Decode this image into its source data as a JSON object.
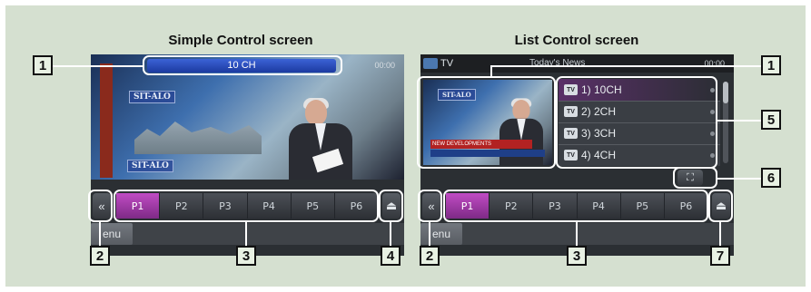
{
  "headings": {
    "simple": "Simple Control screen",
    "list": "List Control screen"
  },
  "simple": {
    "channel_title": "10 CH",
    "clock": "00:00",
    "banner_top": "SIT-ALO",
    "banner_bottom": "SIT-ALO",
    "presets": [
      "P1",
      "P2",
      "P3",
      "P4",
      "P5",
      "P6"
    ],
    "active_preset": "P1",
    "back_button": "«",
    "eject_button": "⏏",
    "menu_label": "enu"
  },
  "list": {
    "source_label": "TV",
    "program_title": "Today's News",
    "clock": "00:00",
    "thumb_banner": "SIT-ALO",
    "thumb_ticker": "NEW DEVELOPMENTS",
    "channels": [
      {
        "icon": "TV",
        "label": "1)  10CH"
      },
      {
        "icon": "TV",
        "label": "2)  2CH"
      },
      {
        "icon": "TV",
        "label": "3)  3CH"
      },
      {
        "icon": "TV",
        "label": "4)  4CH"
      }
    ],
    "presets": [
      "P1",
      "P2",
      "P3",
      "P4",
      "P5",
      "P6"
    ],
    "active_preset": "P1",
    "back_button": "«",
    "eject_button": "⏏",
    "fullscreen_button": "⛶",
    "menu_label": "enu"
  },
  "callouts": {
    "simple_title": "1",
    "list_thumb": "1",
    "simple_back": "2",
    "list_back": "2",
    "simple_presets": "3",
    "list_presets": "3",
    "simple_eject": "4",
    "list_channels": "5",
    "list_fullscreen": "6",
    "list_eject": "7"
  },
  "colors": {
    "background": "#d5e0d0",
    "callout_outline": "#ffffff",
    "active_preset": "#b040b8"
  }
}
